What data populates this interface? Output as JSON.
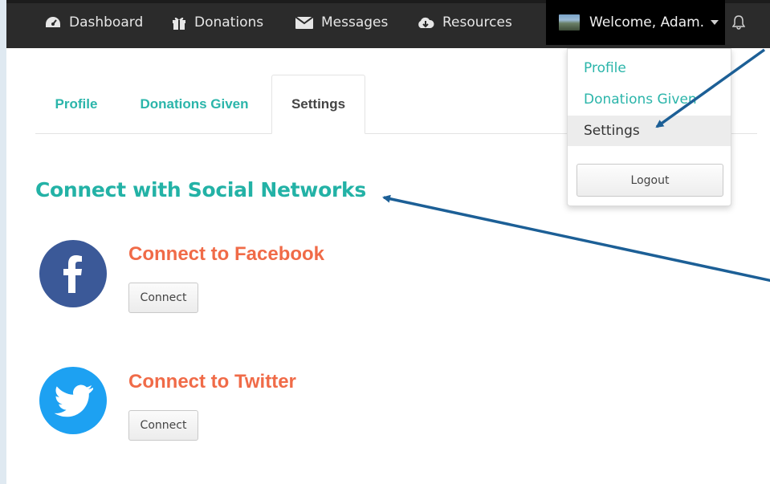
{
  "navbar": {
    "items": [
      {
        "label": "Dashboard",
        "icon": "tachometer-icon"
      },
      {
        "label": "Donations",
        "icon": "gift-icon"
      },
      {
        "label": "Messages",
        "icon": "envelope-icon"
      },
      {
        "label": "Resources",
        "icon": "cloud-download-icon"
      }
    ],
    "welcome": "Welcome, Adam.",
    "notifications_icon": "bell-icon"
  },
  "tabs": [
    {
      "label": "Profile",
      "active": false
    },
    {
      "label": "Donations Given",
      "active": false
    },
    {
      "label": "Settings",
      "active": true
    }
  ],
  "main": {
    "title": "Connect with Social Networks",
    "facebook": {
      "title": "Connect to Facebook",
      "button": "Connect",
      "icon": "facebook-icon"
    },
    "twitter": {
      "title": "Connect to Twitter",
      "button": "Connect",
      "icon": "twitter-icon"
    }
  },
  "dropdown": {
    "items": [
      {
        "label": "Profile"
      },
      {
        "label": "Donations Given"
      },
      {
        "label": "Settings",
        "selected": true
      }
    ],
    "logout": "Logout"
  },
  "colors": {
    "accent": "#2bb5aa",
    "social_title": "#f06b48",
    "annotation_arrow": "#1c5f96",
    "navbar": "#2b2b2b"
  }
}
